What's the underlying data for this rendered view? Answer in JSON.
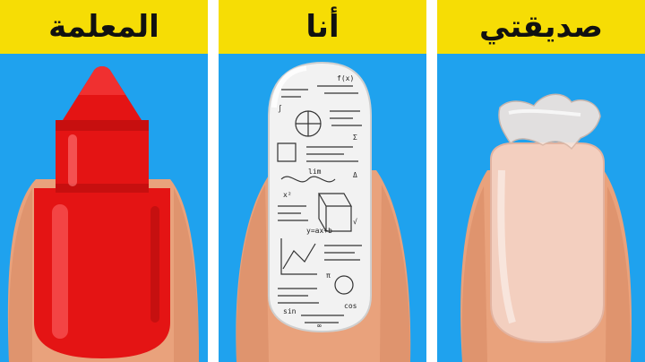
{
  "panels": [
    {
      "label": "المعلمة",
      "nail": "red-lipstick-nail"
    },
    {
      "label": "أنا",
      "nail": "math-formula-nail"
    },
    {
      "label": "صديقتي",
      "nail": "peeling-bare-nail"
    }
  ],
  "colors": {
    "label_bg": "#f6dd05",
    "sky": "#1fa2ee",
    "skin": "#e9a27c",
    "red": "#e41414",
    "paper": "#f2f2f2",
    "bare_nail": "#f3cfbf"
  },
  "formula_marks": [
    "f(x)",
    "∫",
    "Σ",
    "x²",
    "y=ax+b",
    "√",
    "π",
    "sin",
    "cos",
    "lim",
    "Δ",
    "∞"
  ]
}
